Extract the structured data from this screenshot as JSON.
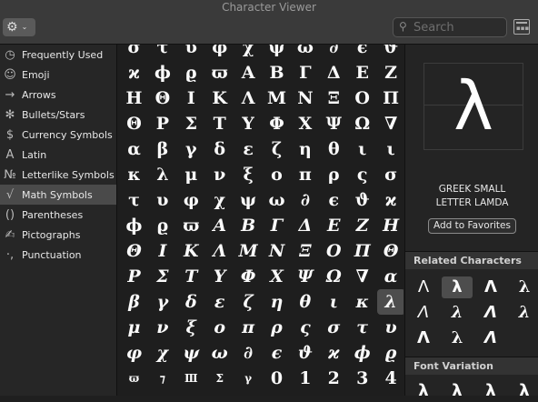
{
  "window": {
    "title": "Character Viewer"
  },
  "toolbar": {
    "gear_icon": "⚙",
    "chevron_icon": "⌄",
    "search_placeholder": "Search",
    "search_icon": "⚲"
  },
  "sidebar": {
    "items": [
      {
        "icon": "◷",
        "label": "Frequently Used"
      },
      {
        "icon": "☺",
        "label": "Emoji"
      },
      {
        "icon": "→",
        "label": "Arrows"
      },
      {
        "icon": "✻",
        "label": "Bullets/Stars"
      },
      {
        "icon": "$",
        "label": "Currency Symbols"
      },
      {
        "icon": "A",
        "label": "Latin"
      },
      {
        "icon": "№",
        "label": "Letterlike Symbols"
      },
      {
        "icon": "√",
        "label": "Math Symbols",
        "selected": true
      },
      {
        "icon": "()",
        "label": "Parentheses"
      },
      {
        "icon": "✍",
        "label": "Pictographs"
      },
      {
        "icon": "·,",
        "label": "Punctuation"
      }
    ]
  },
  "grid": {
    "rows": [
      {
        "italic": false,
        "chars": [
          "σ",
          "τ",
          "υ",
          "φ",
          "χ",
          "ψ",
          "ω",
          "∂",
          "ϵ",
          "ϑ"
        ]
      },
      {
        "italic": false,
        "chars": [
          "ϰ",
          "ϕ",
          "ϱ",
          "ϖ",
          "Α",
          "Β",
          "Γ",
          "Δ",
          "Ε",
          "Ζ"
        ]
      },
      {
        "italic": false,
        "chars": [
          "Η",
          "Θ",
          "Ι",
          "Κ",
          "Λ",
          "Μ",
          "Ν",
          "Ξ",
          "Ο",
          "Π"
        ]
      },
      {
        "italic": false,
        "chars": [
          "Θ",
          "Ρ",
          "Σ",
          "Τ",
          "Υ",
          "Φ",
          "Χ",
          "Ψ",
          "Ω",
          "∇"
        ]
      },
      {
        "italic": false,
        "chars": [
          "α",
          "β",
          "γ",
          "δ",
          "ε",
          "ζ",
          "η",
          "θ",
          "ι",
          "ι"
        ]
      },
      {
        "italic": false,
        "chars": [
          "κ",
          "λ",
          "μ",
          "ν",
          "ξ",
          "ο",
          "π",
          "ρ",
          "ς",
          "σ"
        ]
      },
      {
        "italic": false,
        "chars": [
          "τ",
          "υ",
          "φ",
          "χ",
          "ψ",
          "ω",
          "∂",
          "ϵ",
          "ϑ",
          "ϰ"
        ]
      },
      {
        "italic": false,
        "chars": [
          "ϕ",
          "ϱ",
          "ϖ",
          "Α",
          "Β",
          "Γ",
          "Δ",
          "Ε",
          "Ζ",
          "Η"
        ],
        "italic_from": 3
      },
      {
        "italic": true,
        "chars": [
          "Θ",
          "Ι",
          "Κ",
          "Λ",
          "Μ",
          "Ν",
          "Ξ",
          "Ο",
          "Π",
          "Θ"
        ]
      },
      {
        "italic": true,
        "chars": [
          "Ρ",
          "Σ",
          "Τ",
          "Υ",
          "Φ",
          "Χ",
          "Ψ",
          "Ω",
          "∇",
          "α"
        ]
      },
      {
        "italic": true,
        "chars": [
          "β",
          "γ",
          "δ",
          "ε",
          "ζ",
          "η",
          "θ",
          "ι",
          "κ",
          "λ"
        ]
      },
      {
        "italic": true,
        "chars": [
          "μ",
          "ν",
          "ξ",
          "ο",
          "π",
          "ρ",
          "ς",
          "σ",
          "τ",
          "υ"
        ]
      },
      {
        "italic": true,
        "chars": [
          "φ",
          "χ",
          "ψ",
          "ω",
          "∂",
          "ϵ",
          "ϑ",
          "ϰ",
          "ϕ",
          "ϱ"
        ]
      },
      {
        "italic": false,
        "chars": [
          "ϖ",
          "⁊",
          "Ⅲ",
          "Σ",
          "γ",
          "0",
          "1",
          "2",
          "3",
          "4"
        ]
      }
    ],
    "selected": {
      "row": 10,
      "col": 9
    }
  },
  "preview": {
    "char": "λ",
    "name": "GREEK SMALL LETTER LAMDA",
    "add_favorites_label": "Add to Favorites"
  },
  "related": {
    "title": "Related Characters",
    "rows": [
      [
        "Λ",
        "λ",
        "Λ",
        "λ"
      ],
      [
        "Λ",
        "λ",
        "Λ",
        "λ"
      ],
      [
        "Λ",
        "λ",
        "Λ"
      ]
    ]
  },
  "font_variation": {
    "title": "Font Variation",
    "chars": [
      "λ",
      "λ",
      "λ",
      "λ"
    ]
  }
}
